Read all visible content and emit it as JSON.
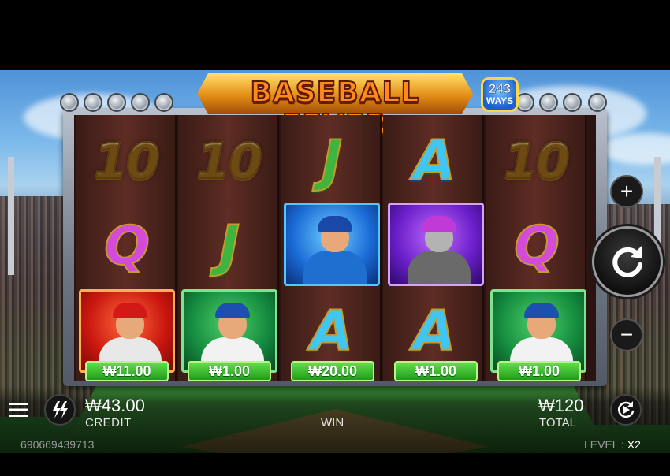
{
  "game": {
    "title": "BASEBALL FEVER",
    "ways_badge": {
      "number": "243",
      "label": "WAYS"
    }
  },
  "reels": [
    {
      "symbols": [
        "10",
        "Q",
        "catcher-red-card"
      ],
      "win": "₩11.00"
    },
    {
      "symbols": [
        "10",
        "J",
        "pitcher-green-card"
      ],
      "win": "₩1.00"
    },
    {
      "symbols": [
        "J",
        "batter-blue-card",
        "A"
      ],
      "win": "₩20.00"
    },
    {
      "symbols": [
        "A",
        "catcher-purple-card",
        "A"
      ],
      "win": "₩1.00"
    },
    {
      "symbols": [
        "10",
        "Q",
        "pitcher-green-card"
      ],
      "win": "₩1.00"
    }
  ],
  "controls": {
    "bet_increase": "+",
    "bet_decrease": "−",
    "spin_icon": "refresh-icon",
    "menu_icon": "menu-icon",
    "turbo_icon": "lightning-icon",
    "autoplay_icon": "autoplay-icon"
  },
  "bottom_bar": {
    "credit_value": "₩43.00",
    "credit_label": "CREDIT",
    "win_label": "WIN",
    "total_value": "₩120",
    "total_label": "TOTAL",
    "session_id": "690669439713",
    "level_label": "LEVEL",
    "level_value": "X2"
  }
}
